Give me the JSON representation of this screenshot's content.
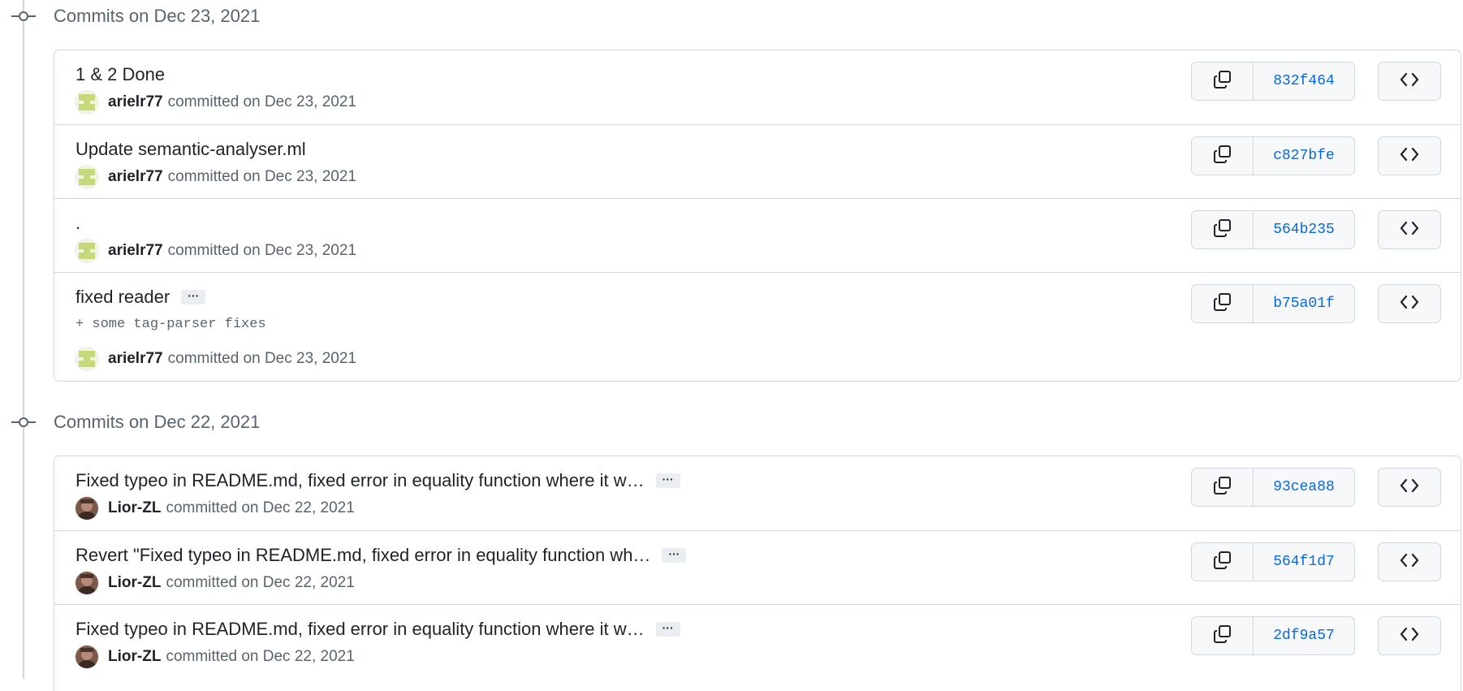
{
  "groups": [
    {
      "title": "Commits on Dec 23, 2021",
      "commits": [
        {
          "title": "1 & 2 Done",
          "author": "arielr77",
          "action": "committed on Dec 23, 2021",
          "sha": "832f464",
          "avatar": "green-identicon"
        },
        {
          "title": "Update semantic-analyser.ml",
          "author": "arielr77",
          "action": "committed on Dec 23, 2021",
          "sha": "c827bfe",
          "avatar": "green-identicon"
        },
        {
          "title": ".",
          "author": "arielr77",
          "action": "committed on Dec 23, 2021",
          "sha": "564b235",
          "avatar": "green-identicon"
        },
        {
          "title": "fixed reader",
          "ellipsis": "···",
          "body": "+ some tag-parser fixes",
          "author": "arielr77",
          "action": "committed on Dec 23, 2021",
          "sha": "b75a01f",
          "avatar": "green-identicon"
        }
      ]
    },
    {
      "title": "Commits on Dec 22, 2021",
      "commits": [
        {
          "title": "Fixed typeo in README.md, fixed error in equality function where it w…",
          "ellipsis": "···",
          "author": "Lior-ZL",
          "action": "committed on Dec 22, 2021",
          "sha": "93cea88",
          "avatar": "photo"
        },
        {
          "title": "Revert \"Fixed typeo in README.md, fixed error in equality function wh…",
          "ellipsis": "···",
          "author": "Lior-ZL",
          "action": "committed on Dec 22, 2021",
          "sha": "564f1d7",
          "avatar": "photo"
        },
        {
          "title": "Fixed typeo in README.md, fixed error in equality function where it w…",
          "ellipsis": "···",
          "author": "Lior-ZL",
          "action": "committed on Dec 22, 2021",
          "sha": "2df9a57",
          "avatar": "photo"
        }
      ]
    }
  ],
  "icons": {
    "commit_node": "git-commit-icon",
    "copy": "copy-icon",
    "browse": "code-icon"
  },
  "colors": {
    "sha_link": "#0969da",
    "muted_text": "#59636e",
    "border": "#d0d7de",
    "button_bg": "#f6f8fa"
  }
}
